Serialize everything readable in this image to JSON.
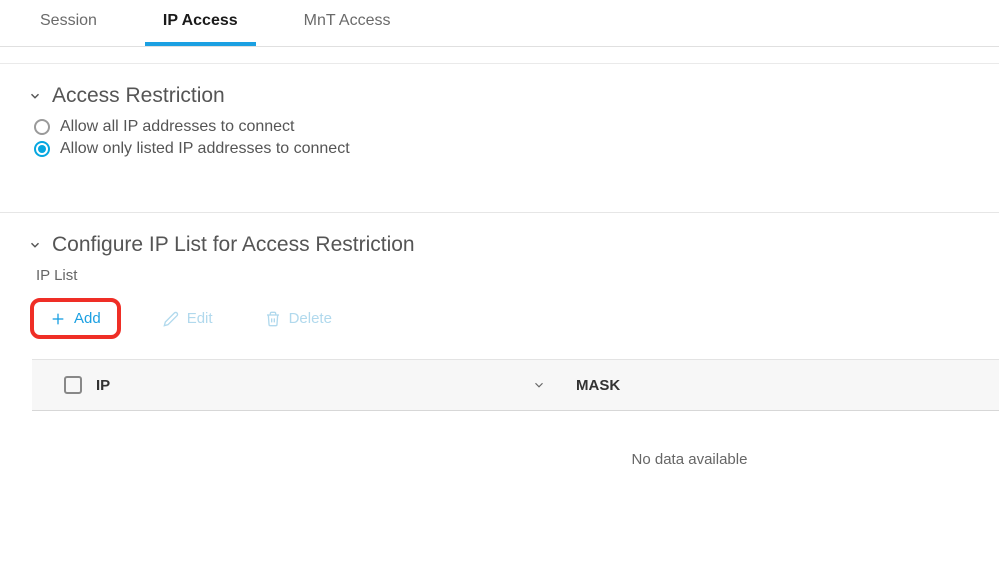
{
  "tabs": {
    "session": "Session",
    "ip_access": "IP Access",
    "mnt_access": "MnT Access"
  },
  "access_restriction": {
    "title": "Access Restriction",
    "option_all": "Allow all IP addresses to connect",
    "option_listed": "Allow only listed IP addresses to connect"
  },
  "ip_list_section": {
    "title": "Configure IP List for Access Restriction",
    "sub_label": "IP List"
  },
  "toolbar": {
    "add": "Add",
    "edit": "Edit",
    "delete": "Delete"
  },
  "table": {
    "col_ip": "IP",
    "col_mask": "MASK",
    "empty": "No data available"
  }
}
